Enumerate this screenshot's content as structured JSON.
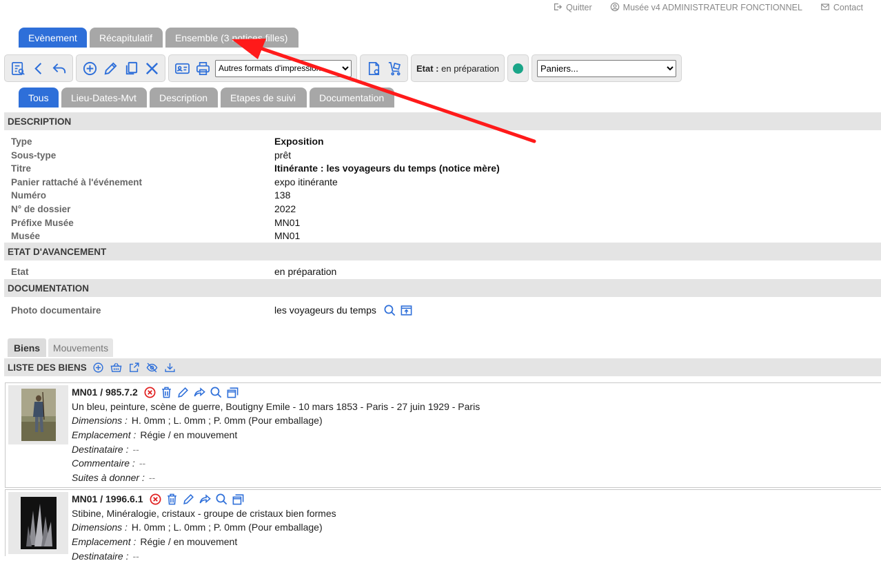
{
  "topbar": {
    "quit": "Quitter",
    "user": "Musée v4 ADMINISTRATEUR FONCTIONNEL",
    "contact": "Contact"
  },
  "main_tabs": [
    "Evènement",
    "Récapitulatif",
    "Ensemble (3 notices filles)"
  ],
  "toolbar": {
    "print_formats_select": "Autres formats d'impression...",
    "etat_label": "Etat :",
    "etat_value": "en préparation",
    "paniers_select": "Paniers...",
    "status_color": "#1aa588"
  },
  "sub_tabs": [
    "Tous",
    "Lieu-Dates-Mvt",
    "Description",
    "Etapes de suivi",
    "Documentation"
  ],
  "description": {
    "title": "DESCRIPTION",
    "fields": [
      {
        "label": "Type",
        "value": "Exposition"
      },
      {
        "label": "Sous-type",
        "value": "prêt"
      },
      {
        "label": "Titre",
        "value": "Itinérante : les voyageurs du temps (notice mère)"
      },
      {
        "label": "Panier rattaché à l'événement",
        "value": "expo itinérante"
      },
      {
        "label": "Numéro",
        "value": "138"
      },
      {
        "label": "N° de dossier",
        "value": "2022"
      },
      {
        "label": "Préfixe Musée",
        "value": "MN01"
      },
      {
        "label": "Musée",
        "value": "MN01"
      }
    ]
  },
  "avancement": {
    "title": "ETAT D'AVANCEMENT",
    "fields": [
      {
        "label": "Etat",
        "value": "en préparation"
      }
    ]
  },
  "documentation": {
    "title": "DOCUMENTATION",
    "fields": [
      {
        "label": "Photo documentaire",
        "value": "les voyageurs du temps"
      }
    ]
  },
  "bottom_tabs": [
    "Biens",
    "Mouvements"
  ],
  "liste_title": "LISTE DES BIENS",
  "items": [
    {
      "ref": "MN01 / 985.7.2",
      "desc": "Un bleu, peinture, scène de guerre, Boutigny Emile - 10 mars 1853 - Paris - 27 juin 1929 - Paris",
      "dimensions_label": "Dimensions :",
      "dimensions": "H. 0mm ; L. 0mm ; P. 0mm (Pour emballage)",
      "emplacement_label": "Emplacement :",
      "emplacement": "Régie / en mouvement",
      "destinataire_label": "Destinataire :",
      "destinataire": "--",
      "commentaire_label": "Commentaire :",
      "commentaire": "--",
      "suites_label": "Suites à donner :",
      "suites": "--"
    },
    {
      "ref": "MN01 / 1996.6.1",
      "desc": "Stibine, Minéralogie, cristaux - groupe de cristaux bien formes",
      "dimensions_label": "Dimensions :",
      "dimensions": "H. 0mm ; L. 0mm ; P. 0mm (Pour emballage)",
      "emplacement_label": "Emplacement :",
      "emplacement": "Régie / en mouvement",
      "destinataire_label": "Destinataire :",
      "destinataire": "--"
    }
  ],
  "colors": {
    "accent": "#2e6fd9",
    "tab_inactive": "#a7a7a7",
    "arrow": "#ff1a1a"
  }
}
